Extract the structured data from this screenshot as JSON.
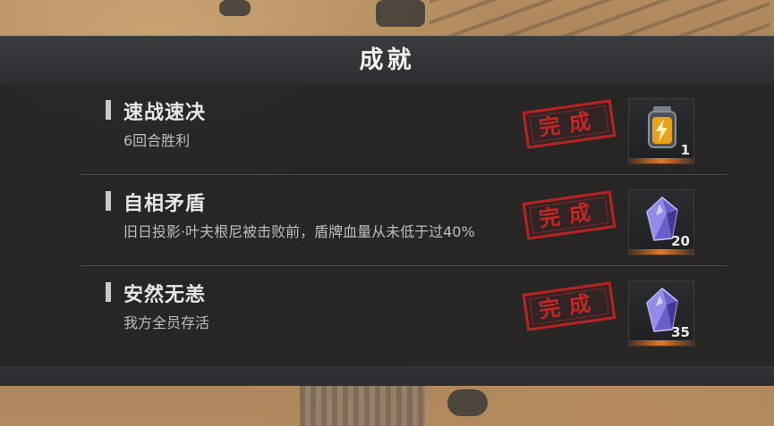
{
  "panel": {
    "title": "成就"
  },
  "achievements": [
    {
      "title": "速战速决",
      "description": "6回合胜利",
      "status": "完成",
      "reward": {
        "icon": "battery-icon",
        "count": "1"
      }
    },
    {
      "title": "自相矛盾",
      "description": "旧日投影·叶夫根尼被击败前，盾牌血量从未低于过40%",
      "status": "完成",
      "reward": {
        "icon": "blue-crystal-icon",
        "count": "20"
      }
    },
    {
      "title": "安然无恙",
      "description": "我方全员存活",
      "status": "完成",
      "reward": {
        "icon": "blue-crystal-icon",
        "count": "35"
      }
    }
  ],
  "colors": {
    "panel_bg": "#1e1f21",
    "stamp_red": "#d42525",
    "reward_glow": "#e07a2e"
  }
}
